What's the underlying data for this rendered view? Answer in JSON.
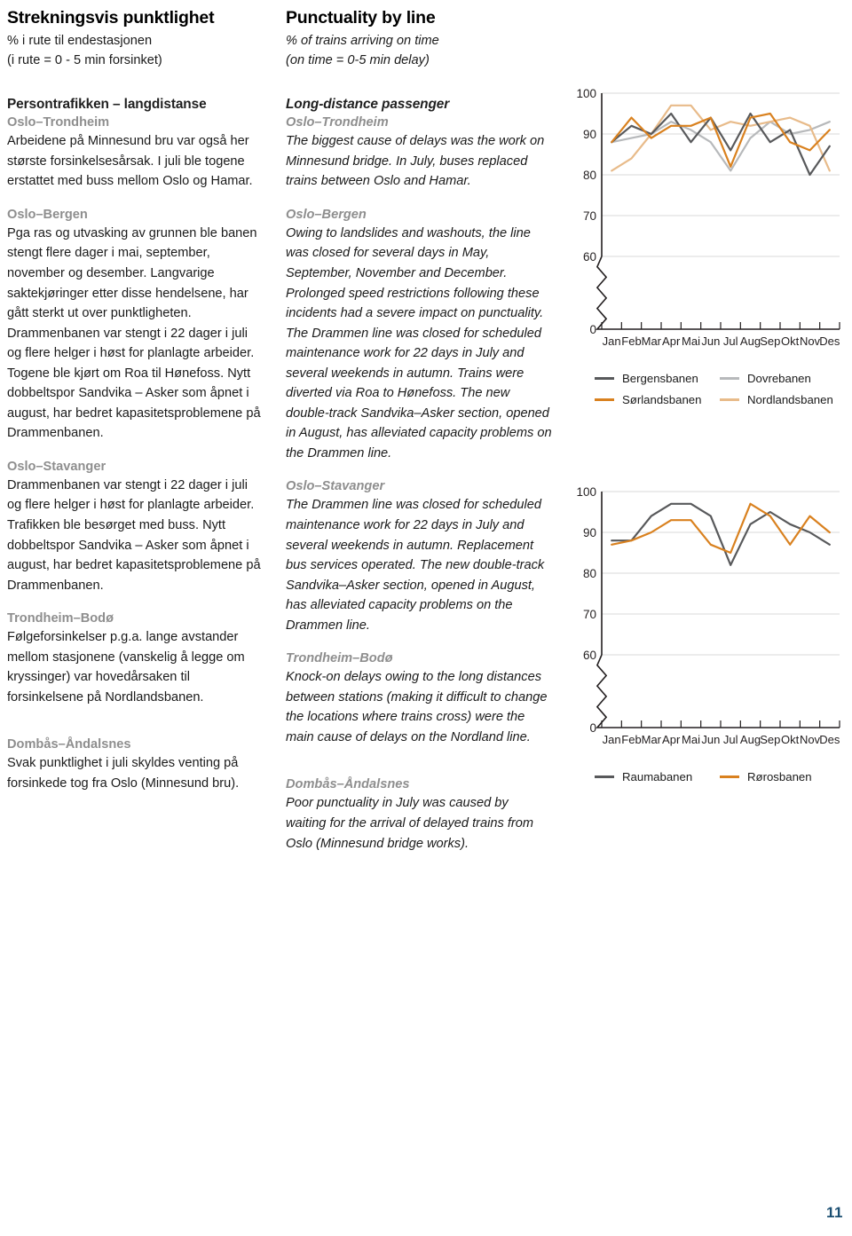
{
  "headers": {
    "no_title": "Strekningsvis punktlighet",
    "no_sub1": "% i rute til endestasjonen",
    "no_sub2": "(i rute = 0 - 5 min forsinket)",
    "en_title": "Punctuality by line",
    "en_sub1": "% of trains arriving on time",
    "en_sub2": "(on time = 0-5 min delay)"
  },
  "no_column": {
    "group_heading": "Persontrafikken – langdistanse",
    "sections": [
      {
        "line": "Oslo–Trondheim",
        "text": "Arbeidene på Minnesund bru var også her største forsinkelsesårsak. I juli ble togene erstattet med buss mellom Oslo og Hamar."
      },
      {
        "line": "Oslo–Bergen",
        "text": "Pga ras og utvasking av grunnen ble banen stengt flere dager i mai, september, november og desember. Langvarige saktekjøringer etter disse hendelsene, har gått sterkt ut over punktligheten. Drammenbanen var stengt i 22 dager i juli og flere helger i høst for planlagte arbeider. Togene ble kjørt om Roa til Hønefoss. Nytt dobbeltspor Sandvika – Asker som åpnet i august, har bedret kapasitetsproblemene på Drammenbanen."
      },
      {
        "line": "Oslo–Stavanger",
        "text": "Drammenbanen var stengt i 22 dager i juli og flere helger i høst for planlagte arbeider. Trafikken ble besørget med buss. Nytt dobbeltspor Sandvika – Asker som åpnet i august, har bedret kapasitetsproblemene på Drammenbanen."
      },
      {
        "line": "Trondheim–Bodø",
        "text": "Følgeforsinkelser p.g.a. lange avstander mellom stasjonene (vanskelig å legge om kryssinger) var hovedårsaken til forsinkelsene på Nordlandsbanen."
      },
      {
        "line": "Dombås–Åndalsnes",
        "text": "Svak punktlighet i juli skyldes venting på forsinkede tog fra Oslo (Minnesund bru)."
      }
    ]
  },
  "en_column": {
    "group_heading": "Long-distance passenger",
    "sections": [
      {
        "line": "Oslo–Trondheim",
        "text": "The biggest cause of delays was the work on Minnesund bridge. In July, buses replaced trains between Oslo and Hamar."
      },
      {
        "line": "Oslo–Bergen",
        "text": "Owing to landslides and washouts, the line was closed for several days in May, September, November and December. Prolonged speed restrictions following these incidents had a severe impact on punctuality. The Drammen line was closed for scheduled maintenance work for 22 days in July and several weekends in autumn. Trains were diverted via Roa to Hønefoss. The new double-track Sandvika–Asker section, opened in August, has alleviated capacity problems on the Drammen line."
      },
      {
        "line": "Oslo–Stavanger",
        "text": "The Drammen line was closed for scheduled maintenance work for 22 days in July and several weekends in autumn. Replacement bus services operated. The new double-track Sandvika–Asker section, opened in August, has alleviated capacity problems on the Drammen line."
      },
      {
        "line": "Trondheim–Bodø",
        "text": "Knock-on delays owing to the long distances between stations (making it difficult to change the locations where trains cross) were the main cause of delays on the Nordland line."
      },
      {
        "line": "Dombås–Åndalsnes",
        "text": "Poor punctuality in July was caused by waiting for the arrival of delayed trains from Oslo (Minnesund bridge works)."
      }
    ]
  },
  "colors": {
    "dark_grey": "#58595b",
    "light_grey": "#b7b9bb",
    "dark_orange": "#d9811f",
    "light_orange": "#e8bb8a",
    "grid": "#d8d8d8",
    "axis": "#231f20",
    "page_number": "#1b4f72"
  },
  "page_number": "11",
  "chart_data": [
    {
      "type": "line",
      "title": "",
      "xlabel": "",
      "ylabel": "",
      "categories": [
        "Jan",
        "Feb",
        "Mar",
        "Apr",
        "Mai",
        "Jun",
        "Jul",
        "Aug",
        "Sep",
        "Okt",
        "Nov",
        "Des"
      ],
      "ylim": [
        0,
        100
      ],
      "yticks": [
        0,
        60,
        70,
        80,
        90,
        100
      ],
      "axis_break": true,
      "grid": true,
      "legend_position": "below",
      "series": [
        {
          "name": "Bergensbanen",
          "color": "#58595b",
          "values": [
            88,
            92,
            90,
            95,
            88,
            94,
            86,
            95,
            88,
            91,
            80,
            87
          ]
        },
        {
          "name": "Dovrebanen",
          "color": "#b7b9bb",
          "values": [
            88,
            89,
            90,
            93,
            91,
            88,
            81,
            89,
            93,
            90,
            91,
            93
          ]
        },
        {
          "name": "Sørlandsbanen",
          "color": "#d9811f",
          "values": [
            88,
            94,
            89,
            92,
            92,
            94,
            82,
            94,
            95,
            88,
            86,
            91
          ]
        },
        {
          "name": "Nordlandsbanen",
          "color": "#e8bb8a",
          "values": [
            81,
            84,
            90,
            97,
            97,
            91,
            93,
            92,
            93,
            94,
            92,
            81
          ]
        }
      ]
    },
    {
      "type": "line",
      "title": "",
      "xlabel": "",
      "ylabel": "",
      "categories": [
        "Jan",
        "Feb",
        "Mar",
        "Apr",
        "Mai",
        "Jun",
        "Jul",
        "Aug",
        "Sep",
        "Okt",
        "Nov",
        "Des"
      ],
      "ylim": [
        0,
        100
      ],
      "yticks": [
        0,
        60,
        70,
        80,
        90,
        100
      ],
      "axis_break": true,
      "grid": true,
      "legend_position": "below",
      "series": [
        {
          "name": "Raumabanen",
          "color": "#58595b",
          "values": [
            88,
            88,
            94,
            97,
            97,
            94,
            82,
            92,
            95,
            92,
            90,
            87
          ]
        },
        {
          "name": "Rørosbanen",
          "color": "#d9811f",
          "values": [
            87,
            88,
            90,
            93,
            93,
            87,
            85,
            97,
            94,
            87,
            94,
            90
          ]
        }
      ]
    }
  ],
  "legends": [
    [
      {
        "label": "Bergensbanen",
        "color": "#58595b"
      },
      {
        "label": "Dovrebanen",
        "color": "#b7b9bb"
      },
      {
        "label": "Sørlandsbanen",
        "color": "#d9811f"
      },
      {
        "label": "Nordlandsbanen",
        "color": "#e8bb8a"
      }
    ],
    [
      {
        "label": "Raumabanen",
        "color": "#58595b"
      },
      {
        "label": "Rørosbanen",
        "color": "#d9811f"
      }
    ]
  ]
}
